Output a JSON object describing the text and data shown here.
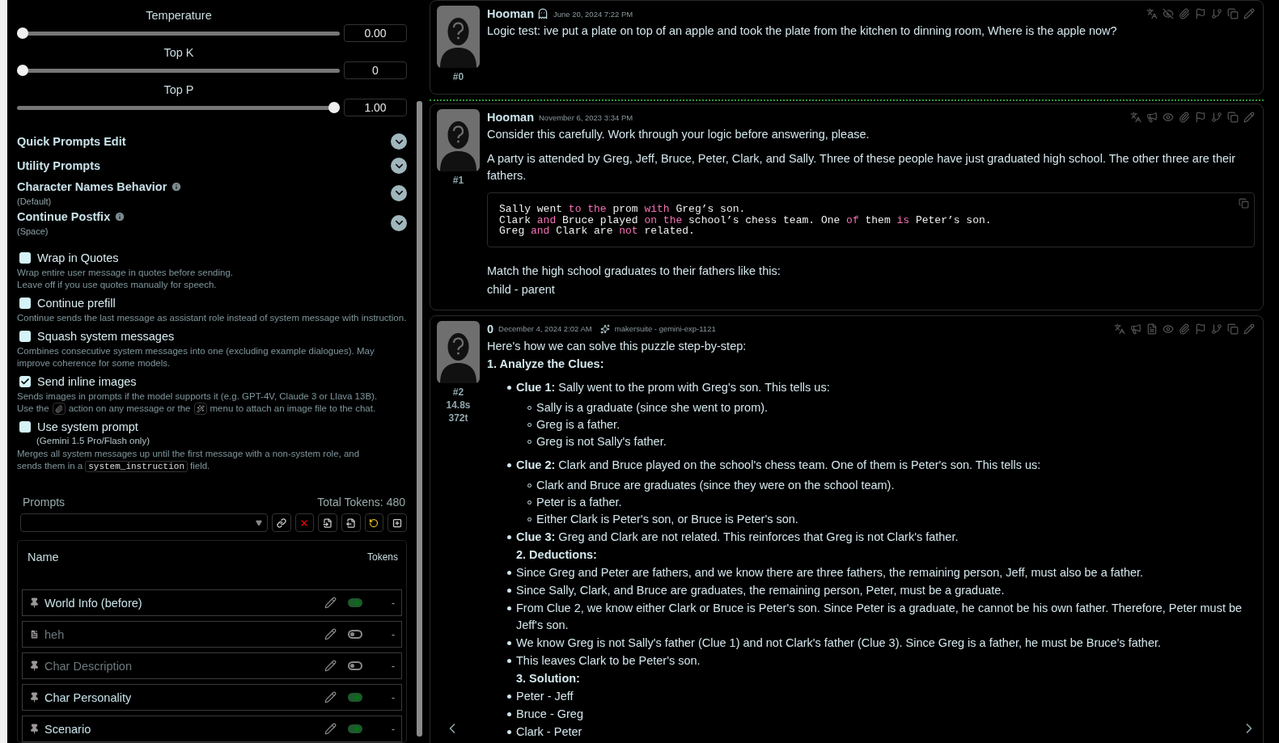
{
  "sliders": [
    {
      "label": "Temperature",
      "level": 0,
      "value": "0.00"
    },
    {
      "label": "Top K",
      "level": 0,
      "value": "0"
    },
    {
      "label": "Top P",
      "level": 1,
      "value": "1.00"
    }
  ],
  "sections": [
    {
      "title": "Quick Prompts Edit",
      "info": false
    },
    {
      "title": "Utility Prompts",
      "info": false
    },
    {
      "title": "Character Names Behavior",
      "info": true,
      "value": "(Default)"
    },
    {
      "title": "Continue Postfix",
      "info": true,
      "value": "(Space)"
    }
  ],
  "options": [
    {
      "label": "Wrap in Quotes",
      "checked": false,
      "description": [
        {
          "kind": "text",
          "text": "Wrap entire user message in quotes before sending."
        },
        {
          "kind": "break"
        },
        {
          "kind": "text",
          "text": "Leave off if you use quotes manually for speech."
        }
      ]
    },
    {
      "label": "Continue prefill",
      "checked": false,
      "description": [
        {
          "kind": "text",
          "text": "Continue sends the last message as assistant role instead of system message with instruction."
        }
      ]
    },
    {
      "label": "Squash system messages",
      "checked": false,
      "description": [
        {
          "kind": "text",
          "text": "Combines consecutive system messages into one (excluding example dialogues). May improve coherence for some models."
        }
      ]
    },
    {
      "label": "Send inline images",
      "checked": true,
      "description": [
        {
          "kind": "text",
          "text": "Sends images in prompts if the model supports it (e.g. GPT-4V, Claude 3 or Llava 13B)."
        },
        {
          "kind": "break"
        },
        {
          "kind": "text",
          "text": "Use the"
        },
        {
          "kind": "attach"
        },
        {
          "kind": "text",
          "text": "action on any message or the"
        },
        {
          "kind": "magic"
        },
        {
          "kind": "text",
          "text": "menu to attach an image file to the chat."
        }
      ]
    },
    {
      "label": "Use system prompt",
      "checked": false,
      "note": "(Gemini 1.5 Pro/Flash only)",
      "description": [
        {
          "kind": "text",
          "text": "Merges all system messages up until the first message with a non-system role, and"
        },
        {
          "kind": "break"
        },
        {
          "kind": "text",
          "text": "sends them in a"
        },
        {
          "kind": "code",
          "text": "system_instruction"
        },
        {
          "kind": "text",
          "text": "field."
        }
      ]
    }
  ],
  "prompts": {
    "title": "Prompts",
    "total": "Total Tokens: 480",
    "columns": [
      "Name",
      "Tokens"
    ],
    "rows": [
      {
        "kind": "pinned",
        "name": "World Info (before)",
        "enabled": true,
        "tokens": "-"
      },
      {
        "kind": "custom",
        "name": "heh",
        "enabled": false,
        "tokens": "-"
      },
      {
        "kind": "pinned",
        "name": "Char Description",
        "enabled": false,
        "tokens": "-"
      },
      {
        "kind": "pinned",
        "name": "Char Personality",
        "enabled": true,
        "tokens": "-"
      },
      {
        "kind": "pinned",
        "name": "Scenario",
        "enabled": true,
        "tokens": "-"
      }
    ]
  },
  "messages": [
    {
      "kind": "user",
      "name": "Hooman",
      "hidden": true,
      "highlighted": false,
      "time": "June 20, 2024 7:22 PM",
      "id": "#0",
      "blocks": [
        {
          "kind": "para",
          "text": "Logic test: ive put a plate on top of an apple and took the plate from the kitchen to dinning room, Where is the apple now?"
        }
      ]
    },
    {
      "kind": "user",
      "name": "Hooman",
      "hidden": false,
      "highlighted": true,
      "time": "November 6, 2023 3:34 PM",
      "id": "#1",
      "blocks": [
        {
          "kind": "para",
          "text": "Consider this carefully. Work through your logic before answering, please."
        },
        {
          "kind": "para",
          "text": "A party is attended by Greg, Jeff, Bruce, Peter, Clark, and Sally. Three of these people have just graduated high school. The other three are their fathers."
        },
        {
          "kind": "code",
          "lines": [
            [
              {
                "text": "Sally went ",
                "keyword": false
              },
              {
                "text": "to the",
                "keyword": true
              },
              {
                "text": " prom ",
                "keyword": false
              },
              {
                "text": "with",
                "keyword": true
              },
              {
                "text": " Greg’s son.",
                "keyword": false
              }
            ],
            [
              {
                "text": "Clark ",
                "keyword": false
              },
              {
                "text": "and",
                "keyword": true
              },
              {
                "text": " Bruce played ",
                "keyword": false
              },
              {
                "text": "on the",
                "keyword": true
              },
              {
                "text": " school’s chess team. One ",
                "keyword": false
              },
              {
                "text": "of",
                "keyword": true
              },
              {
                "text": " them ",
                "keyword": false
              },
              {
                "text": "is",
                "keyword": true
              },
              {
                "text": " Peter’s son.",
                "keyword": false
              }
            ],
            [
              {
                "text": "Greg ",
                "keyword": false
              },
              {
                "text": "and",
                "keyword": true
              },
              {
                "text": " Clark are ",
                "keyword": false
              },
              {
                "text": "not",
                "keyword": true
              },
              {
                "text": " related.",
                "keyword": false
              }
            ]
          ]
        },
        {
          "kind": "para",
          "text": "Match the high school graduates to their fathers like this:"
        },
        {
          "kind": "tight",
          "text": "child - parent"
        }
      ]
    },
    {
      "kind": "assistant",
      "name": "0",
      "hidden": false,
      "highlighted": false,
      "time": "December 4, 2024 2:02 AM",
      "model": "makersuite - gemini-exp-1121",
      "id": "#2",
      "timer": "14.8s",
      "tokens": "372t",
      "blocks": [
        {
          "kind": "tight",
          "text": "Here's how we can solve this puzzle step-by-step:"
        },
        {
          "kind": "heading",
          "text": "1. Analyze the Clues:"
        },
        {
          "kind": "bullet",
          "text": "**Clue 1:** Sally went to the prom with Greg's son. This tells us:",
          "children": [
            "Sally is a graduate (since she went to prom).",
            "Greg is a father.",
            "Greg is not Sally's father."
          ]
        },
        {
          "kind": "bullet",
          "text": "**Clue 2:** Clark and Bruce played on the school's chess team. One of them is Peter's son. This tells us:",
          "children": [
            "Clark and Bruce are graduates (since they were on the school team).",
            "Peter is a father.",
            "Either Clark is Peter's son, or Bruce is Peter's son."
          ]
        },
        {
          "kind": "bullet",
          "text": "**Clue 3:** Greg and Clark are not related. This reinforces that Greg is not Clark's father."
        },
        {
          "kind": "subheading",
          "text": "2. Deductions:"
        },
        {
          "kind": "bullet",
          "text": "Since Greg and Peter are fathers, and we know there are three fathers, the remaining person, Jeff, must also be a father."
        },
        {
          "kind": "bullet",
          "text": "Since Sally, Clark, and Bruce are graduates, the remaining person, Peter, must be a graduate."
        },
        {
          "kind": "bullet",
          "text": "From Clue 2, we know either Clark or Bruce is Peter's son. Since Peter is a graduate, he cannot be his own father. Therefore, Peter must be Jeff's son."
        },
        {
          "kind": "bullet",
          "text": "We know Greg is not Sally's father (Clue 1) and not Clark's father (Clue 3). Since Greg is a father, he must be Bruce's father."
        },
        {
          "kind": "bullet",
          "text": "This leaves Clark to be Peter's son."
        },
        {
          "kind": "subheading",
          "text": "3. Solution:"
        },
        {
          "kind": "bullet",
          "text": "Peter - Jeff"
        },
        {
          "kind": "bullet",
          "text": "Bruce - Greg"
        },
        {
          "kind": "bullet",
          "text": "Clark - Peter"
        }
      ]
    }
  ]
}
